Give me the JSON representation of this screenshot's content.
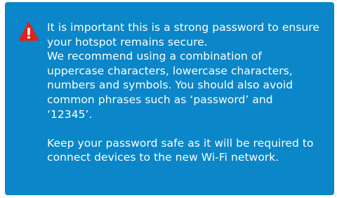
{
  "colors": {
    "panel_background": "#0b86c8",
    "icon_red": "#e32119",
    "text": "#ffffff"
  },
  "icon": "warning-triangle-icon",
  "notice": {
    "paragraph_1": "It is important this is a strong password to ensure your hotspot remains secure.\nWe recommend using a combination of uppercase characters, lowercase characters, numbers and symbols. You should also avoid common phrases such as ‘password’ and ‘12345’.",
    "paragraph_2": "Keep your password safe as it will be required to connect devices to the new Wi-Fi network."
  }
}
